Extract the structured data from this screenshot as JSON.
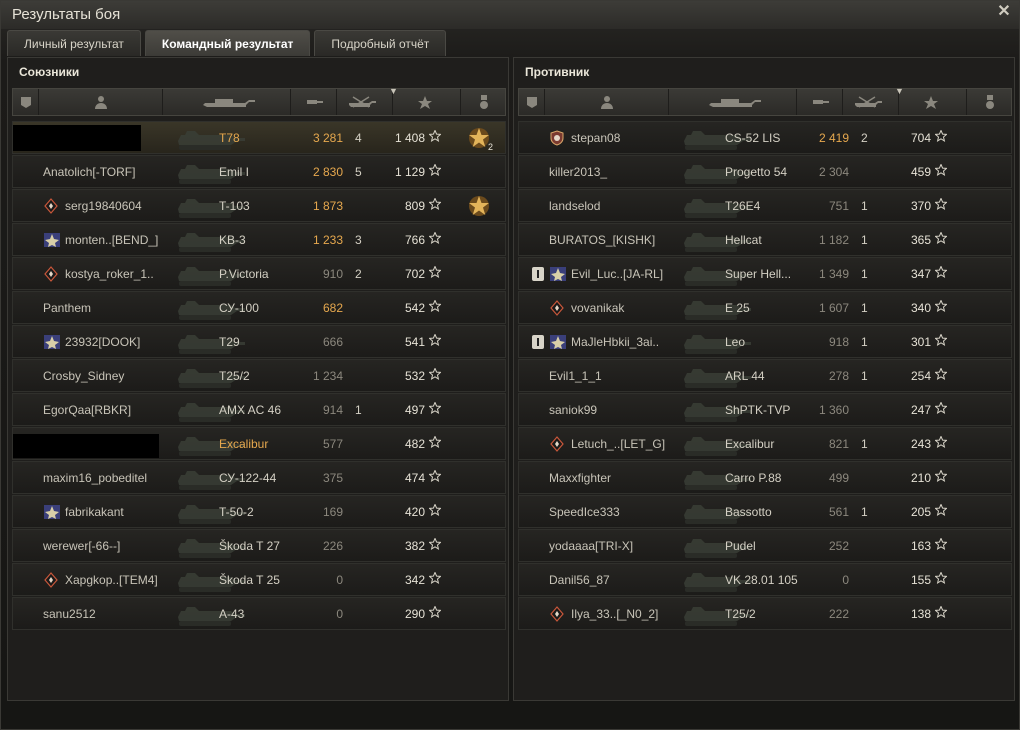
{
  "window": {
    "title": "Результаты боя",
    "close_icon": "close-icon"
  },
  "tabs": [
    {
      "label": "Личный результат",
      "active": false
    },
    {
      "label": "Командный результат",
      "active": true
    },
    {
      "label": "Подробный отчёт",
      "active": false
    }
  ],
  "allies": {
    "title": "Союзники",
    "rows": [
      {
        "name": "",
        "tank": "T78",
        "damage": "3 281",
        "frags": "4",
        "xp": "1 408",
        "me": true,
        "redacted": true,
        "medal": "order-icon",
        "medal_count": "2"
      },
      {
        "name": "Anatolich[-TORF]",
        "tank": "Emil I",
        "damage": "2 830",
        "frags": "5",
        "xp": "1 129"
      },
      {
        "name": "serg19840604",
        "tank": "T-103",
        "damage": "1 873",
        "frags": "",
        "xp": "809",
        "badge": "diamond-badge-icon",
        "medal": "order-icon"
      },
      {
        "name": "monten..[BEND_]",
        "tank": "KB-3",
        "damage": "1 233",
        "frags": "3",
        "xp": "766",
        "badge": "clan-emblem-icon"
      },
      {
        "name": "kostya_roker_1..",
        "tank": "P.Victoria",
        "damage": "910",
        "frags": "2",
        "xp": "702",
        "badge": "diamond-badge-icon",
        "dim": true
      },
      {
        "name": "Panthem",
        "tank": "СУ-100",
        "damage": "682",
        "frags": "",
        "xp": "542"
      },
      {
        "name": "23932[DOOK]",
        "tank": "T29",
        "damage": "666",
        "frags": "",
        "xp": "541",
        "badge": "clan-emblem-icon",
        "dim": true
      },
      {
        "name": "Crosby_Sidney",
        "tank": "T25/2",
        "damage": "1 234",
        "frags": "",
        "xp": "532",
        "dim": true
      },
      {
        "name": "EgorQaa[RBKR]",
        "tank": "AMX AC 46",
        "damage": "914",
        "frags": "1",
        "xp": "497",
        "dim": true
      },
      {
        "name": "",
        "tank": "Excalibur",
        "damage": "577",
        "frags": "",
        "xp": "482",
        "redacted2": true,
        "gold_tank": true
      },
      {
        "name": "maxim16_pobeditel",
        "tank": "СУ-122-44",
        "damage": "375",
        "frags": "",
        "xp": "474",
        "dim": true
      },
      {
        "name": "fabrikakant",
        "tank": "T-50-2",
        "damage": "169",
        "frags": "",
        "xp": "420",
        "badge": "clan-emblem-icon",
        "dim": true
      },
      {
        "name": "werewer[-66--]",
        "tank": "Škoda T 27",
        "damage": "226",
        "frags": "",
        "xp": "382",
        "dim": true
      },
      {
        "name": "Xapgkop..[TEM4]",
        "tank": "Škoda T 25",
        "damage": "0",
        "frags": "",
        "xp": "342",
        "badge": "diamond-badge-icon",
        "dim": true
      },
      {
        "name": "sanu2512",
        "tank": "A-43",
        "damage": "0",
        "frags": "",
        "xp": "290",
        "dim": true
      }
    ]
  },
  "enemies": {
    "title": "Противник",
    "rows": [
      {
        "name": "stepan08",
        "tank": "CS-52 LIS",
        "damage": "2 419",
        "frags": "2",
        "xp": "704",
        "badge": "shield-badge-icon"
      },
      {
        "name": "killer2013_",
        "tank": "Progetto 54",
        "damage": "2 304",
        "frags": "",
        "xp": "459",
        "dim": true
      },
      {
        "name": "landselod",
        "tank": "T26E4",
        "damage": "751",
        "frags": "1",
        "xp": "370",
        "dim": true
      },
      {
        "name": "BURATOS_[KISHK]",
        "tank": "Hellcat",
        "damage": "1 182",
        "frags": "1",
        "xp": "365",
        "dim": true
      },
      {
        "name": "Evil_Luc..[JA-RL]",
        "tank": "Super Hell...",
        "damage": "1 349",
        "frags": "1",
        "xp": "347",
        "badge": "clan-emblem-icon",
        "platoon": true,
        "dim": true
      },
      {
        "name": "vovanikak",
        "tank": "E 25",
        "damage": "1 607",
        "frags": "1",
        "xp": "340",
        "badge": "diamond-badge-icon",
        "dim": true
      },
      {
        "name": "MaJleHbkii_3ai..",
        "tank": "Leo",
        "damage": "918",
        "frags": "1",
        "xp": "301",
        "badge": "clan-emblem-icon",
        "platoon": true,
        "dim": true
      },
      {
        "name": "Evil1_1_1",
        "tank": "ARL 44",
        "damage": "278",
        "frags": "1",
        "xp": "254",
        "dim": true
      },
      {
        "name": "saniok99",
        "tank": "ShPTK-TVP",
        "damage": "1 360",
        "frags": "",
        "xp": "247",
        "dim": true
      },
      {
        "name": "Letuch_..[LET_G]",
        "tank": "Excalibur",
        "damage": "821",
        "frags": "1",
        "xp": "243",
        "badge": "diamond-badge-icon",
        "dim": true
      },
      {
        "name": "Maxxfighter",
        "tank": "Carro P.88",
        "damage": "499",
        "frags": "",
        "xp": "210",
        "dim": true
      },
      {
        "name": "SpeedIce333",
        "tank": "Bassotto",
        "damage": "561",
        "frags": "1",
        "xp": "205",
        "dim": true
      },
      {
        "name": "yodaaaa[TRI-X]",
        "tank": "Pudel",
        "damage": "252",
        "frags": "",
        "xp": "163",
        "dim": true
      },
      {
        "name": "Danil56_87",
        "tank": "VK 28.01 105",
        "damage": "0",
        "frags": "",
        "xp": "155",
        "dim": true
      },
      {
        "name": "Ilya_33..[_N0_2]",
        "tank": "T25/2",
        "damage": "222",
        "frags": "",
        "xp": "138",
        "badge": "diamond-badge-icon",
        "dim": true
      }
    ]
  },
  "colors": {
    "accent": "#e6a84e",
    "text": "#c8c4b8",
    "dim": "#8c887e"
  }
}
